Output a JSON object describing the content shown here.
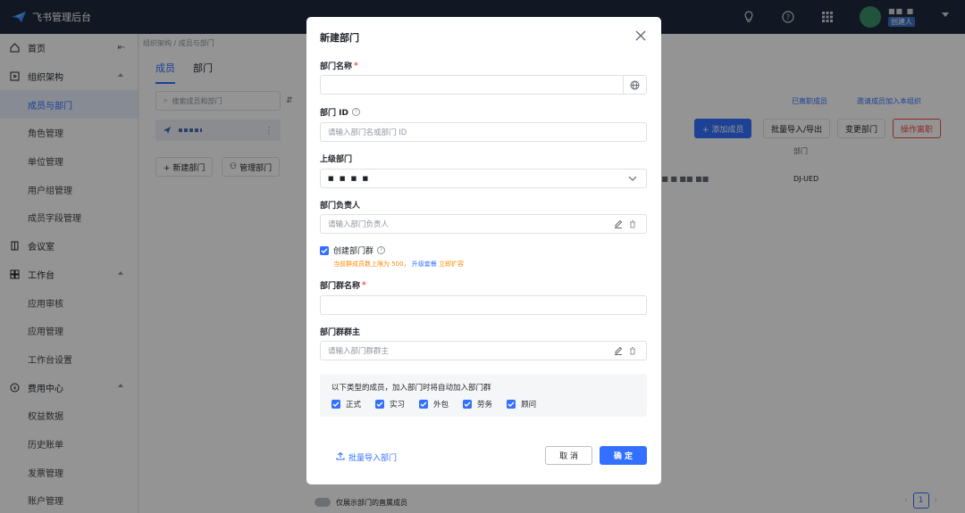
{
  "topbar": {
    "app_title": "飞书管理后台",
    "user_name": "■■ ■",
    "user_role": "创建人"
  },
  "sidebar": {
    "items": [
      {
        "label": "首页",
        "icon": "home-icon"
      },
      {
        "label": "组织架构",
        "icon": "org-icon"
      },
      {
        "label": "成员与部门"
      },
      {
        "label": "角色管理"
      },
      {
        "label": "单位管理"
      },
      {
        "label": "用户组管理"
      },
      {
        "label": "成员字段管理"
      },
      {
        "label": "会议室",
        "icon": "meeting-room-icon"
      },
      {
        "label": "工作台",
        "icon": "workbench-icon"
      },
      {
        "label": "应用审核"
      },
      {
        "label": "应用管理"
      },
      {
        "label": "工作台设置"
      },
      {
        "label": "费用中心",
        "icon": "billing-icon"
      },
      {
        "label": "权益数据"
      },
      {
        "label": "历史账单"
      },
      {
        "label": "发票管理"
      },
      {
        "label": "账户管理"
      }
    ]
  },
  "background": {
    "breadcrumb": "组织架构 / 成员与部门",
    "tabs": [
      "成员",
      "部门"
    ],
    "search_placeholder": "搜索成员和部门",
    "tree_node": "■■",
    "new_dept_btn": "+ 新建部门",
    "manage_dept_btn": "管理部门",
    "resigned_link": "已离职成员",
    "invite_link": "邀请成员加入本组织",
    "add_member_btn": "+ 添加成员",
    "batch_io_btn": "批量导入/导出",
    "change_dept_btn": "变更部门",
    "resign_btn": "操作离职",
    "col_dept": "部门",
    "cell_dept": "DJ-UED",
    "cell_masked": "\" ■ ■ ■■ ■■",
    "toggle_label": "仅展示部门的直属成员",
    "page": "1"
  },
  "modal": {
    "title": "新建部门",
    "dept_name_label": "部门名称",
    "dept_id_label": "部门 ID",
    "dept_id_placeholder": "请输入部门名或部门 ID",
    "parent_label": "上级部门",
    "parent_value": "■ ■ ■ ■",
    "leader_label": "部门负责人",
    "leader_placeholder": "请输入部门负责人",
    "create_group_label": "创建部门群",
    "note_text": "当前群成员数上限为 500，",
    "note_link": "升级套餐",
    "note_suffix": "立即扩容",
    "group_name_label": "部门群名称",
    "group_owner_label": "部门群群主",
    "group_owner_placeholder": "请输入部门群群主",
    "auto_title": "以下类型的成员，加入部门时将自动加入部门群",
    "auto_options": [
      "正式",
      "实习",
      "外包",
      "劳务",
      "顾问"
    ],
    "batch_import": "批量导入部门",
    "cancel": "取 消",
    "ok": "确 定"
  },
  "colors": {
    "primary": "#3370ff",
    "danger": "#f54a45",
    "warning": "#ff8800",
    "topbar": "#1f2a3d"
  }
}
